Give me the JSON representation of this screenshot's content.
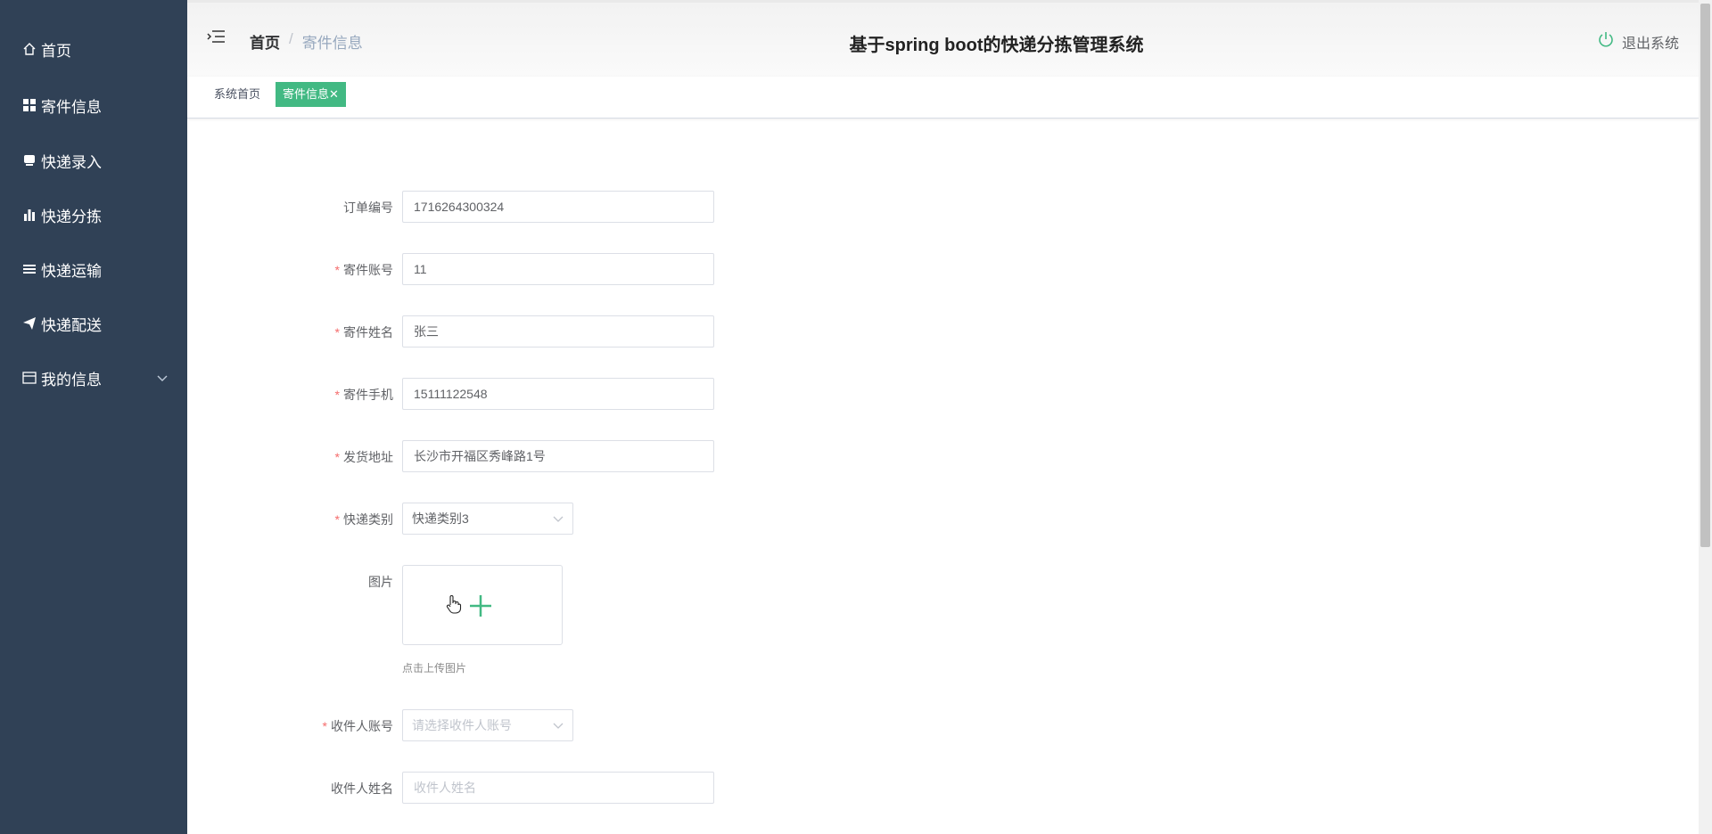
{
  "sidebar": {
    "items": [
      {
        "label": "首页",
        "icon": "home-icon"
      },
      {
        "label": "寄件信息",
        "icon": "grid-icon"
      },
      {
        "label": "快递录入",
        "icon": "box-icon"
      },
      {
        "label": "快递分拣",
        "icon": "bar-chart-icon"
      },
      {
        "label": "快递运输",
        "icon": "list-icon"
      },
      {
        "label": "快递配送",
        "icon": "send-icon"
      },
      {
        "label": "我的信息",
        "icon": "card-icon"
      }
    ]
  },
  "header": {
    "breadcrumb": {
      "home": "首页",
      "separator": "/",
      "current": "寄件信息"
    },
    "title": "基于spring boot的快递分拣管理系统",
    "logout_label": "退出系统"
  },
  "tags": {
    "home": "系统首页",
    "active": "寄件信息",
    "close": "✕"
  },
  "form": {
    "order_no": {
      "label": "订单编号",
      "value": "1716264300324"
    },
    "sender_account": {
      "label": "寄件账号",
      "value": "11"
    },
    "sender_name": {
      "label": "寄件姓名",
      "value": "张三"
    },
    "sender_phone": {
      "label": "寄件手机",
      "value": "15111122548"
    },
    "ship_address": {
      "label": "发货地址",
      "value": "长沙市开福区秀峰路1号"
    },
    "express_type": {
      "label": "快递类别",
      "value": "快递类别3"
    },
    "image": {
      "label": "图片",
      "tip": "点击上传图片"
    },
    "receiver_account": {
      "label": "收件人账号",
      "placeholder": "请选择收件人账号"
    },
    "receiver_name": {
      "label": "收件人姓名",
      "placeholder": "收件人姓名"
    }
  },
  "colors": {
    "sidebar": "#304156",
    "accent": "#42b983",
    "required": "#f56c6c"
  }
}
